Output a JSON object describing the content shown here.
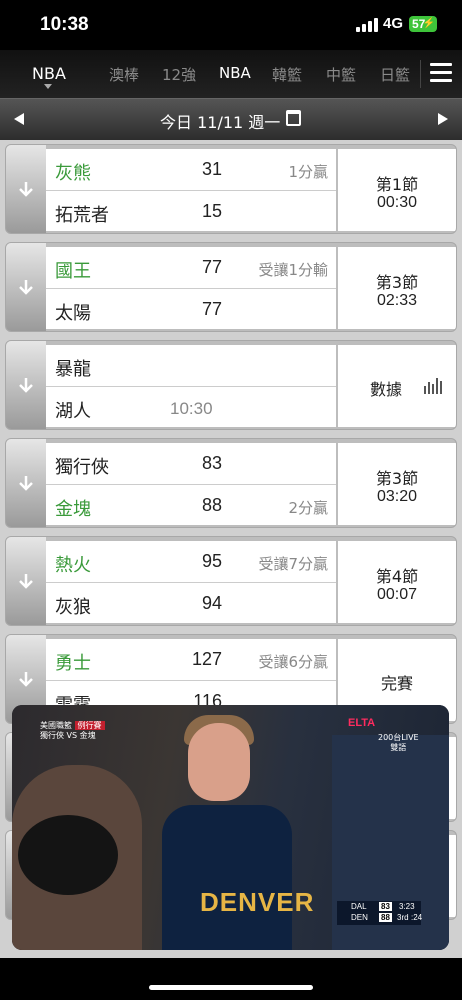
{
  "status_bar": {
    "time": "10:38",
    "network": "4G",
    "battery": "57"
  },
  "league_tabs": {
    "current": "NBA",
    "items": [
      {
        "label": "澳棒",
        "active": false
      },
      {
        "label": "12強",
        "active": false
      },
      {
        "label": "NBA",
        "active": true
      },
      {
        "label": "韓籃",
        "active": false
      },
      {
        "label": "中籃",
        "active": false
      },
      {
        "label": "日籃",
        "active": false
      }
    ]
  },
  "date_bar": {
    "label": "今日 11/11 週一"
  },
  "games": [
    {
      "team1": "灰熊",
      "score1": "31",
      "note1": "1分贏",
      "team2": "拓荒者",
      "score2": "15",
      "note2": "",
      "status1": "第1節",
      "status2": "00:30"
    },
    {
      "team1": "國王",
      "score1": "77",
      "note1": "受讓1分輸",
      "team2": "太陽",
      "score2": "77",
      "note2": "",
      "status1": "第3節",
      "status2": "02:33"
    },
    {
      "team1": "暴龍",
      "score1": "",
      "note1": "",
      "team2": "湖人",
      "start_time": "10:30",
      "status_single": "數據"
    },
    {
      "team1": "獨行俠",
      "score1": "83",
      "note1": "",
      "team2": "金塊",
      "score2": "88",
      "note2": "2分贏",
      "status1": "第3節",
      "status2": "03:20"
    },
    {
      "team1": "熱火",
      "score1": "95",
      "note1": "受讓7分贏",
      "team2": "灰狼",
      "score2": "94",
      "note2": "",
      "status1": "第4節",
      "status2": "00:07"
    },
    {
      "team1": "勇士",
      "score1": "127",
      "note1": "受讓6分贏",
      "team2": "雷霆",
      "score2": "116",
      "note2": "",
      "status_single": "完賽"
    }
  ],
  "video": {
    "league_label": "美國職籃",
    "season_tag": "例行賽",
    "matchup": "獨行俠 VS 金塊",
    "broadcaster": "ELTA",
    "channel": "200台LIVE",
    "audio": "雙語",
    "jersey_text": "DENVER",
    "scoreboard": {
      "away": "DAL",
      "away_score": "83",
      "clock": "3:23",
      "home": "DEN",
      "home_score": "88",
      "period": "3rd",
      "shot_clock": ":24"
    }
  }
}
